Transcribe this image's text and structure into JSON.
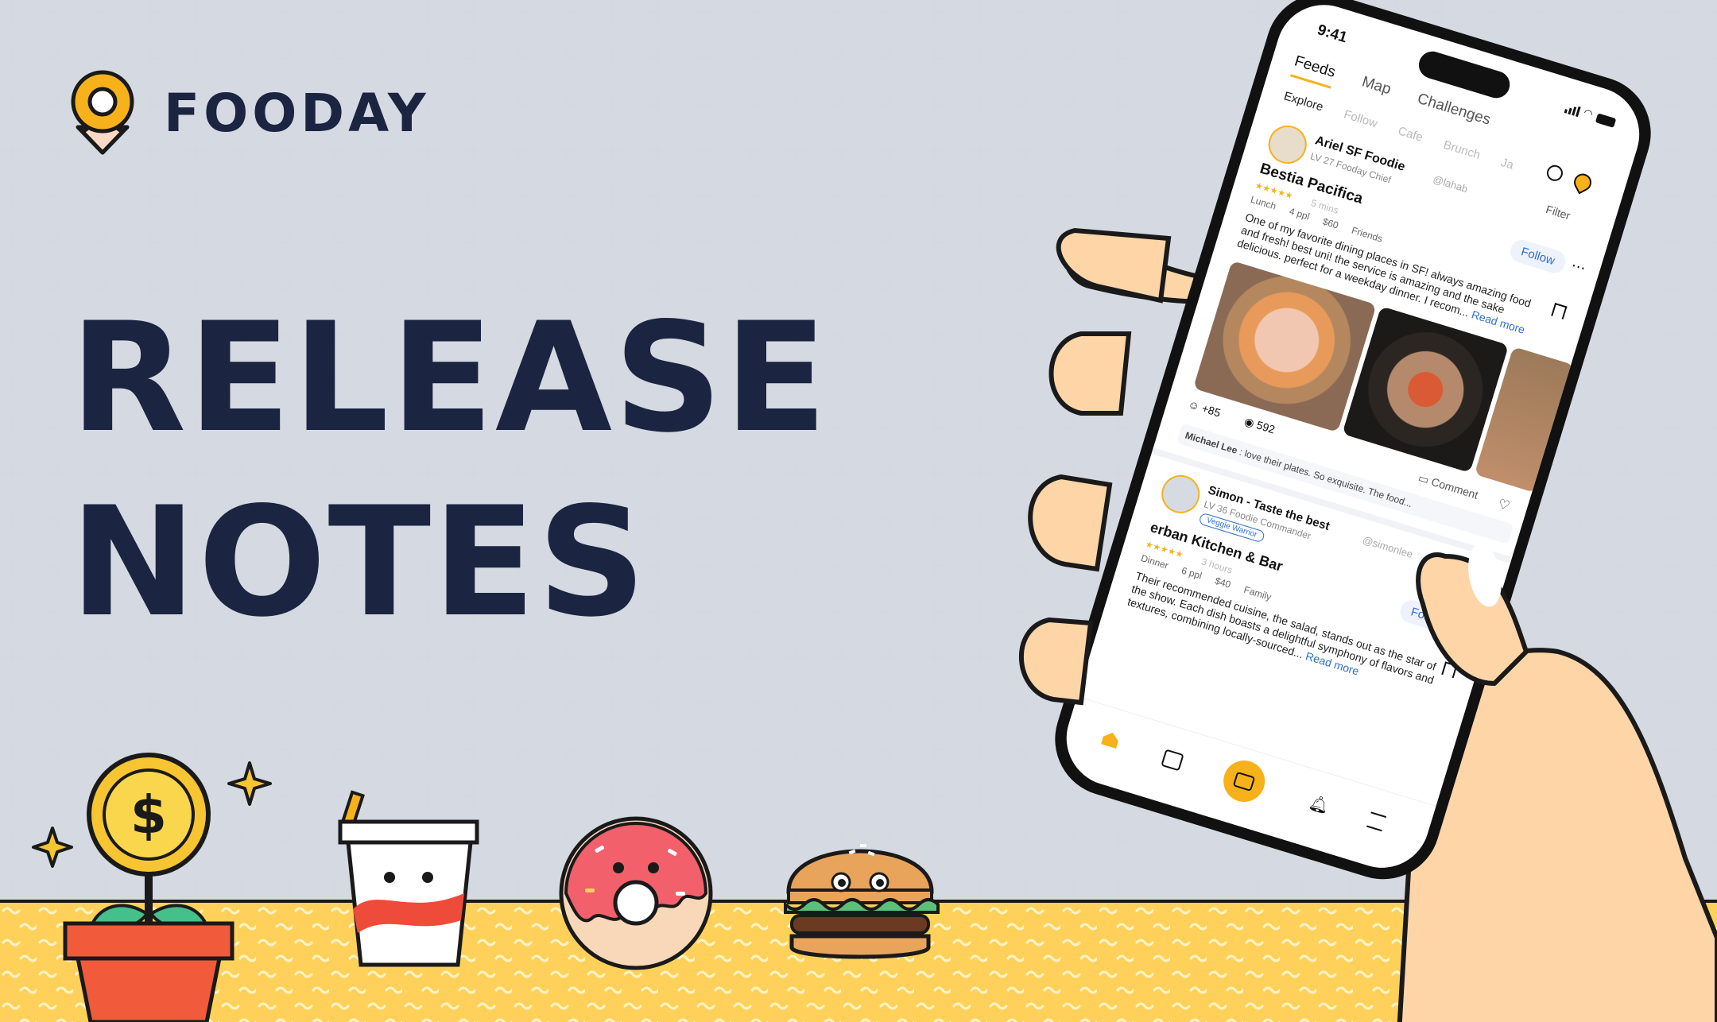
{
  "brand": {
    "name": "FOODAY"
  },
  "headline": {
    "line1": "RELEASE",
    "line2": "NOTES"
  },
  "colors": {
    "accent": "#f7b21b",
    "navy": "#1b2440",
    "ground": "#ffd15a",
    "link": "#2f6fd1"
  },
  "phone": {
    "status_time": "9:41",
    "top_tabs": [
      "Feeds",
      "Map",
      "Challenges"
    ],
    "sub_tabs": [
      "Explore",
      "Follow",
      "Cafe",
      "Brunch",
      "Ja"
    ],
    "filter_label": "Filter",
    "post1": {
      "author": "Ariel SF Foodie",
      "handle": "@lahab",
      "level": "LV 27 Fooday Chief",
      "follow": "Follow",
      "restaurant": "Bestia Pacifica",
      "rating": "★★★★★",
      "time": "5 mins",
      "meta": [
        "Lunch",
        "4 ppl",
        "$60",
        "Friends"
      ],
      "text": "One of my favorite dining places in SF! always amazing food and fresh! best uni! the service is amazing and the sake delicious. perfect for a weekday dinner. I recom...",
      "read_more": "Read more",
      "likes": "+85",
      "views": "592",
      "comment_label": "Comment",
      "comment_author": "Michael Lee",
      "comment_text": " : love their plates. So exquisite. The food..."
    },
    "post2": {
      "author": "Simon -  Taste the best",
      "handle": "@simonlee",
      "level": "LV 36 Foodie Commander",
      "badge": "Veggie Warrior",
      "follow": "Follow",
      "restaurant": "erban Kitchen & Bar",
      "rating": "★★★★★",
      "time": "3 hours",
      "meta": [
        "Dinner",
        "6 ppl",
        "$40",
        "Family"
      ],
      "text": "Their recommended cuisine, the salad, stands out as the star of the show. Each dish boasts a delightful symphony of flavors and textures, combining locally-sourced...",
      "read_more": "Read more"
    }
  }
}
